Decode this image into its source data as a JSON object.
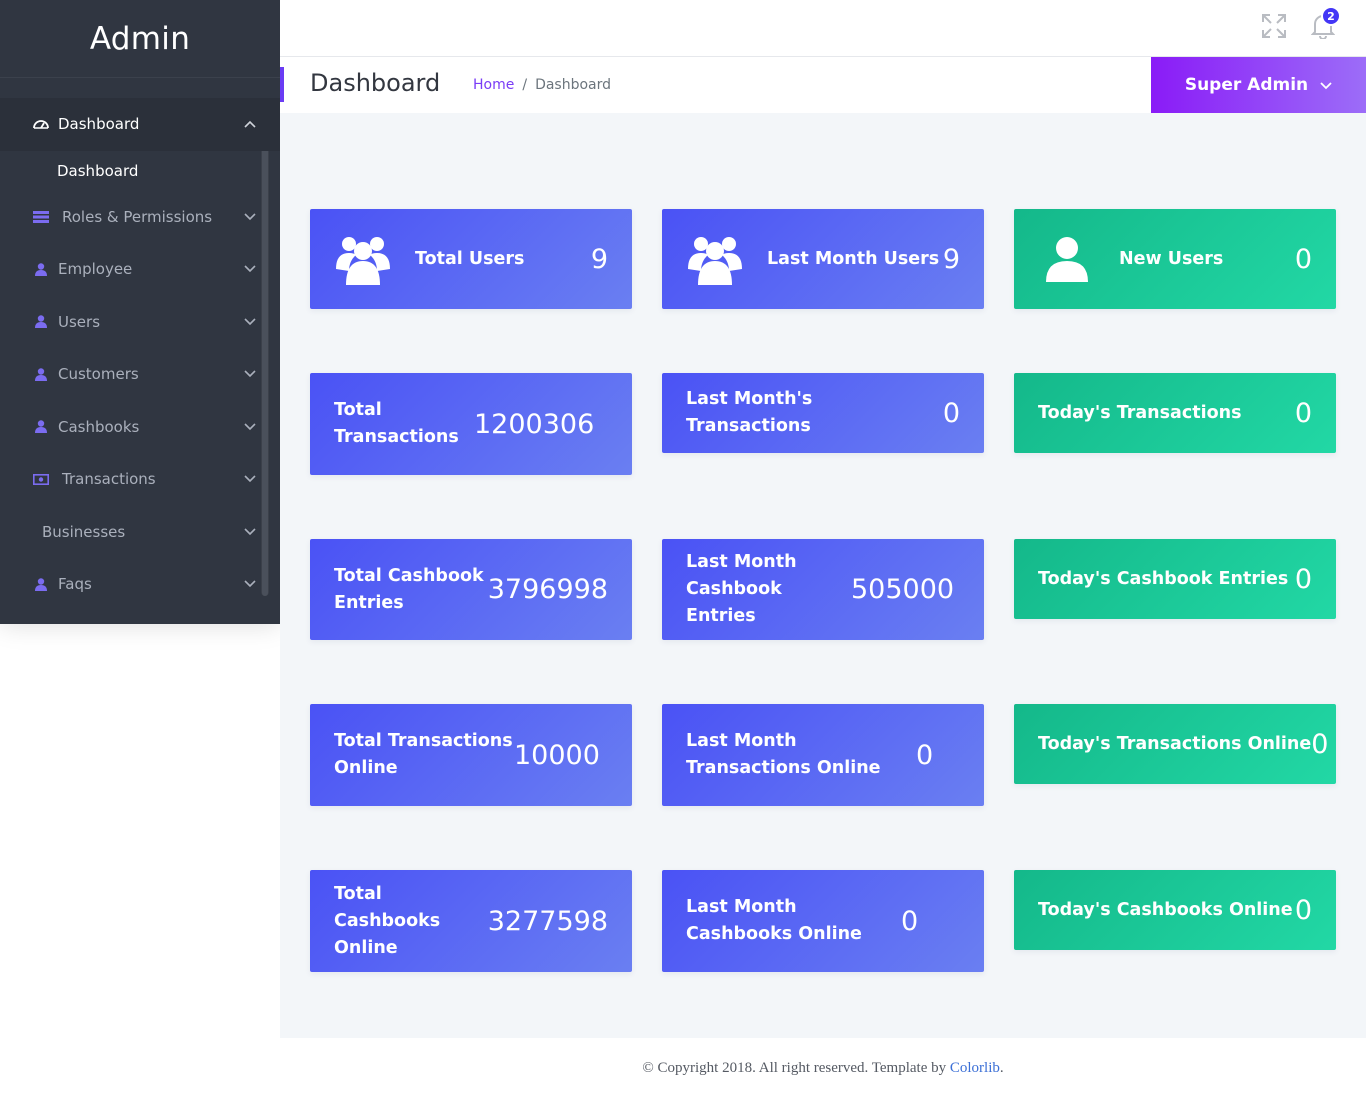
{
  "sidebar": {
    "logo": "Admin",
    "items": [
      {
        "label": "Dashboard",
        "icon": "dashboard-icon"
      },
      {
        "label": "Roles & Permissions",
        "icon": "table-icon"
      },
      {
        "label": "Employee",
        "icon": "user-icon"
      },
      {
        "label": "Users",
        "icon": "user-icon"
      },
      {
        "label": "Customers",
        "icon": "user-icon"
      },
      {
        "label": "Cashbooks",
        "icon": "user-icon"
      },
      {
        "label": "Transactions",
        "icon": "money-icon"
      },
      {
        "label": "Businesses",
        "icon": ""
      },
      {
        "label": "Faqs",
        "icon": "user-icon"
      }
    ],
    "submenu": {
      "label": "Dashboard"
    }
  },
  "header": {
    "notification_count": "2",
    "fullscreen_icon": "fullscreen-icon",
    "bell_icon": "bell-icon"
  },
  "titlebar": {
    "title": "Dashboard",
    "breadcrumb": {
      "home": "Home",
      "separator": "/",
      "current": "Dashboard"
    },
    "user": "Super Admin"
  },
  "cards": [
    {
      "label": "Total Users",
      "value": "9",
      "icon": "users-group-icon",
      "color": "blue"
    },
    {
      "label": "Last Month Users",
      "value": "9",
      "icon": "users-group-icon",
      "color": "blue"
    },
    {
      "label": "New Users",
      "value": "0",
      "icon": "user-icon",
      "color": "green"
    },
    {
      "label": "Total Transactions",
      "value": "1200306",
      "color": "blue"
    },
    {
      "label": "Last Month's Transactions",
      "value": "0",
      "color": "blue"
    },
    {
      "label": "Today's Transactions",
      "value": "0",
      "color": "green"
    },
    {
      "label": "Total Cashbook Entries",
      "value": "3796998",
      "color": "blue"
    },
    {
      "label": "Last Month Cashbook Entries",
      "value": "505000",
      "color": "blue"
    },
    {
      "label": "Today's Cashbook Entries",
      "value": "0",
      "color": "green"
    },
    {
      "label": "Total Transactions Online",
      "value": "10000",
      "color": "blue"
    },
    {
      "label": "Last Month Transactions Online",
      "value": "0",
      "color": "blue"
    },
    {
      "label": "Today's Transactions Online",
      "value": "0",
      "color": "green"
    },
    {
      "label": "Total Cashbooks Online",
      "value": "3277598",
      "color": "blue"
    },
    {
      "label": "Last Month Cashbooks Online",
      "value": "0",
      "color": "blue"
    },
    {
      "label": "Today's Cashbooks Online",
      "value": "0",
      "color": "green"
    }
  ],
  "footer": {
    "text": "© Copyright 2018. All right reserved. Template by ",
    "link": "Colorlib",
    "end": "."
  },
  "colors": {
    "sidebar_bg": "#303641",
    "accent_purple": "#8a1bf7",
    "card_blue": "#4a52f5",
    "card_green": "#14b88a",
    "content_bg": "#f3f6f9"
  }
}
